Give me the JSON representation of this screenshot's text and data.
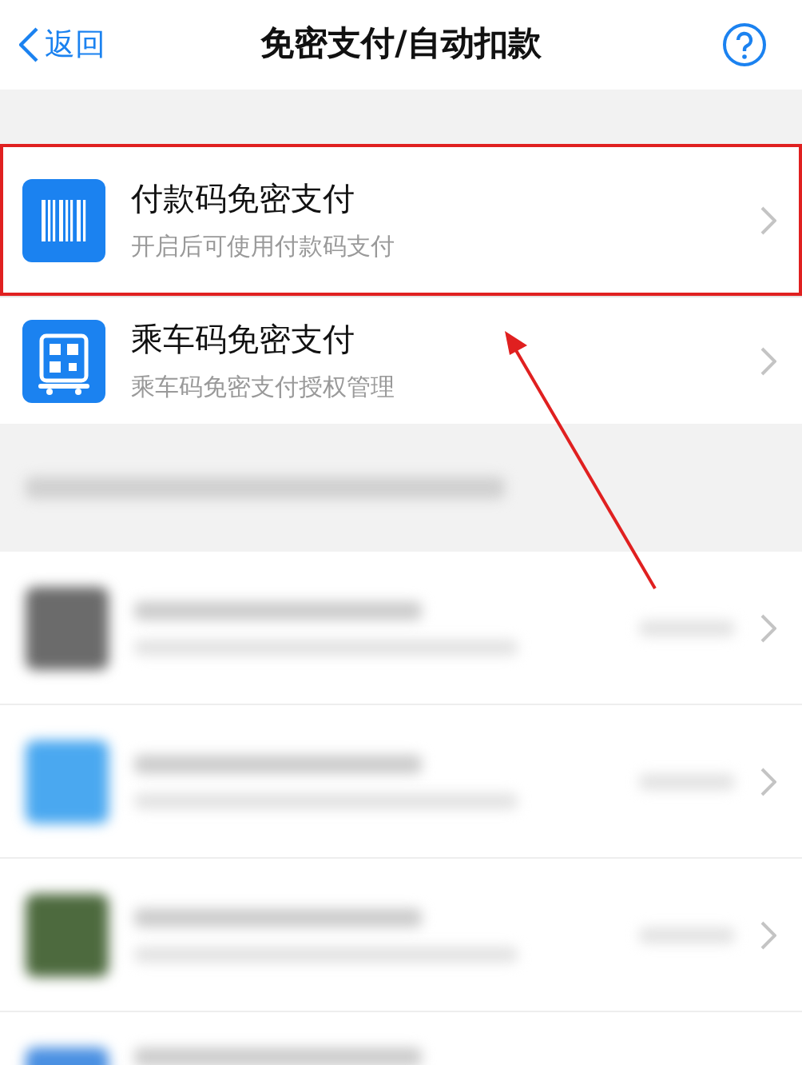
{
  "nav": {
    "back": "返回",
    "title": "免密支付/自动扣款"
  },
  "items": [
    {
      "kind": "barcode",
      "title": "付款码免密支付",
      "subtitle": "开启后可使用付款码支付",
      "highlighted": true
    },
    {
      "kind": "qr",
      "title": "乘车码免密支付",
      "subtitle": "乘车码免密支付授权管理",
      "highlighted": false
    }
  ],
  "blurred_rows": [
    {
      "color": "#6b6b6b"
    },
    {
      "color": "#4aa8f0"
    },
    {
      "color": "#4d6a3e"
    },
    {
      "color": "#4a90e2"
    }
  ]
}
